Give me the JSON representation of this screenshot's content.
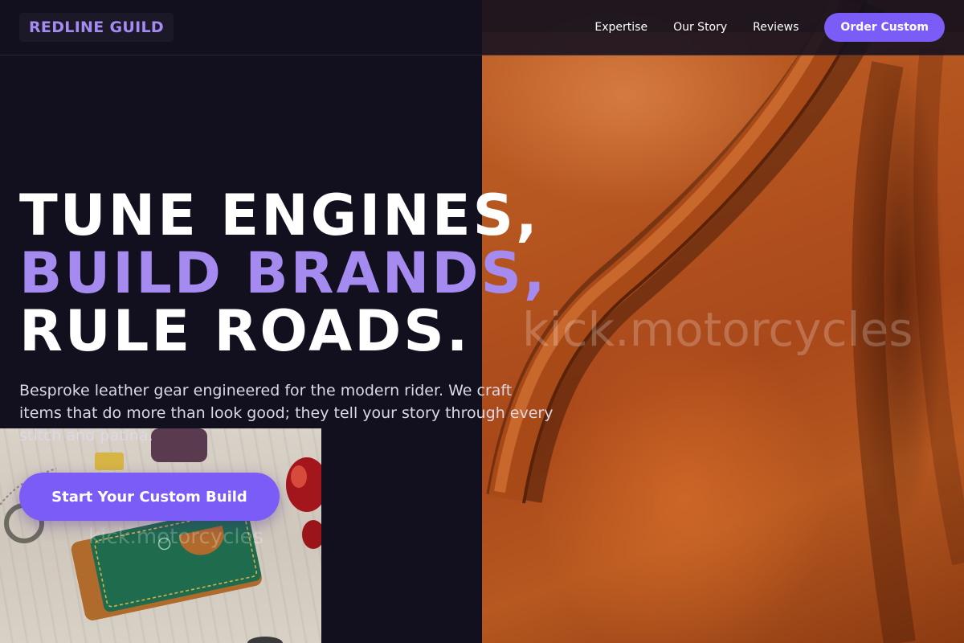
{
  "header": {
    "logo": "REDLINE GUILD",
    "nav": [
      {
        "label": "Expertise"
      },
      {
        "label": "Our Story"
      },
      {
        "label": "Reviews"
      }
    ],
    "cta_label": "Order Custom"
  },
  "hero": {
    "heading_line1": "TUNE ENGINES,",
    "heading_line2": "BUILD BRANDS,",
    "heading_line3": "RULE ROADS.",
    "subtext": "Besproke leather gear engineered for the modern rider. We craft items that do more than look good; they tell your story through every stitch and patina.",
    "cta_label": "Start Your Custom Build"
  },
  "images": {
    "leather_watermark": "kick.motorcycles",
    "wallet_watermark": "kick.motorcycles"
  },
  "colors": {
    "background": "#12101f",
    "accent": "#7b5cf6",
    "accent_light": "#a58bf0",
    "text": "#ffffff"
  }
}
